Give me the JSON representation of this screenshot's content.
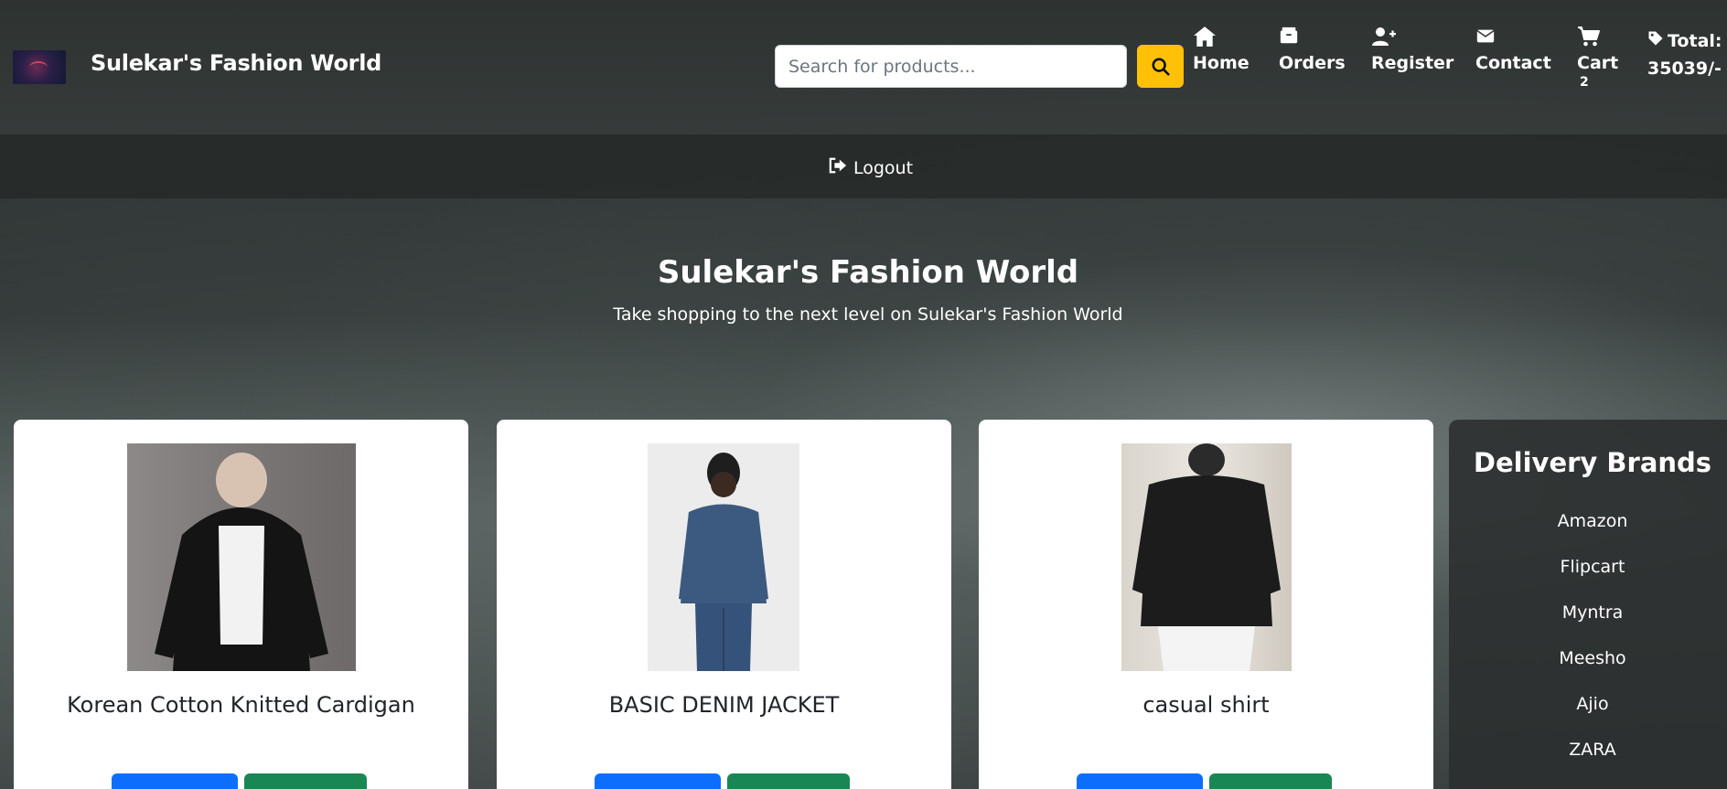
{
  "header": {
    "brand": "Sulekar's Fashion World",
    "search_placeholder": "Search for products...",
    "nav": {
      "home": "Home",
      "orders": "Orders",
      "register": "Register",
      "contact": "Contact",
      "cart": "Cart",
      "cart_count": "2",
      "total_label": "Total:",
      "total_value": "35039/-"
    },
    "logout": "Logout"
  },
  "hero": {
    "title": "Sulekar's Fashion World",
    "subtitle": "Take shopping to the next level on Sulekar's Fashion World"
  },
  "products": [
    {
      "name": "Korean Cotton Knitted Cardigan"
    },
    {
      "name": "BASIC DENIM JACKET"
    },
    {
      "name": "casual shirt"
    }
  ],
  "delivery": {
    "title": "Delivery Brands",
    "brands": [
      "Amazon",
      "Flipcart",
      "Myntra",
      "Meesho",
      "Ajio",
      "ZARA"
    ]
  },
  "colors": {
    "accent_search": "#ffc107",
    "button_primary": "#0d6efd",
    "button_success": "#198754"
  }
}
